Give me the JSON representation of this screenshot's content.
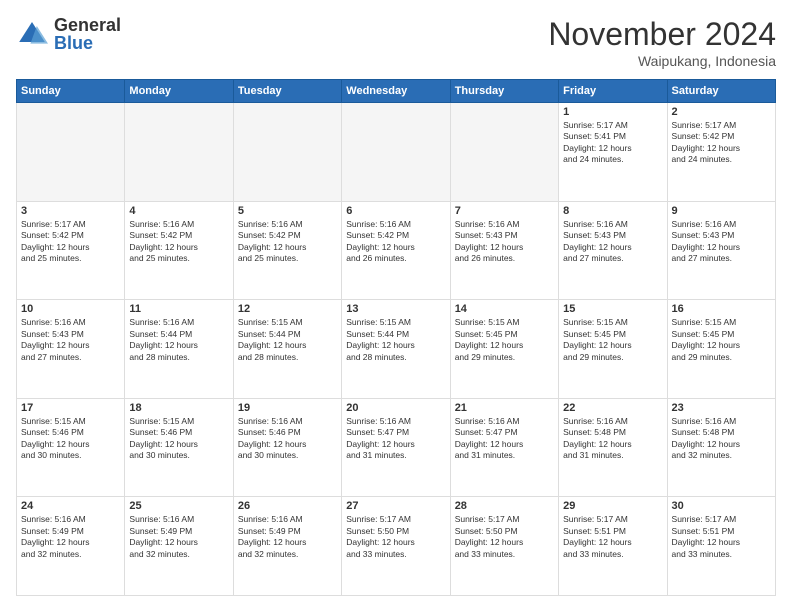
{
  "logo": {
    "general": "General",
    "blue": "Blue"
  },
  "header": {
    "month": "November 2024",
    "location": "Waipukang, Indonesia"
  },
  "weekdays": [
    "Sunday",
    "Monday",
    "Tuesday",
    "Wednesday",
    "Thursday",
    "Friday",
    "Saturday"
  ],
  "weeks": [
    [
      {
        "day": "",
        "info": ""
      },
      {
        "day": "",
        "info": ""
      },
      {
        "day": "",
        "info": ""
      },
      {
        "day": "",
        "info": ""
      },
      {
        "day": "",
        "info": ""
      },
      {
        "day": "1",
        "info": "Sunrise: 5:17 AM\nSunset: 5:41 PM\nDaylight: 12 hours\nand 24 minutes."
      },
      {
        "day": "2",
        "info": "Sunrise: 5:17 AM\nSunset: 5:42 PM\nDaylight: 12 hours\nand 24 minutes."
      }
    ],
    [
      {
        "day": "3",
        "info": "Sunrise: 5:17 AM\nSunset: 5:42 PM\nDaylight: 12 hours\nand 25 minutes."
      },
      {
        "day": "4",
        "info": "Sunrise: 5:16 AM\nSunset: 5:42 PM\nDaylight: 12 hours\nand 25 minutes."
      },
      {
        "day": "5",
        "info": "Sunrise: 5:16 AM\nSunset: 5:42 PM\nDaylight: 12 hours\nand 25 minutes."
      },
      {
        "day": "6",
        "info": "Sunrise: 5:16 AM\nSunset: 5:42 PM\nDaylight: 12 hours\nand 26 minutes."
      },
      {
        "day": "7",
        "info": "Sunrise: 5:16 AM\nSunset: 5:43 PM\nDaylight: 12 hours\nand 26 minutes."
      },
      {
        "day": "8",
        "info": "Sunrise: 5:16 AM\nSunset: 5:43 PM\nDaylight: 12 hours\nand 27 minutes."
      },
      {
        "day": "9",
        "info": "Sunrise: 5:16 AM\nSunset: 5:43 PM\nDaylight: 12 hours\nand 27 minutes."
      }
    ],
    [
      {
        "day": "10",
        "info": "Sunrise: 5:16 AM\nSunset: 5:43 PM\nDaylight: 12 hours\nand 27 minutes."
      },
      {
        "day": "11",
        "info": "Sunrise: 5:16 AM\nSunset: 5:44 PM\nDaylight: 12 hours\nand 28 minutes."
      },
      {
        "day": "12",
        "info": "Sunrise: 5:15 AM\nSunset: 5:44 PM\nDaylight: 12 hours\nand 28 minutes."
      },
      {
        "day": "13",
        "info": "Sunrise: 5:15 AM\nSunset: 5:44 PM\nDaylight: 12 hours\nand 28 minutes."
      },
      {
        "day": "14",
        "info": "Sunrise: 5:15 AM\nSunset: 5:45 PM\nDaylight: 12 hours\nand 29 minutes."
      },
      {
        "day": "15",
        "info": "Sunrise: 5:15 AM\nSunset: 5:45 PM\nDaylight: 12 hours\nand 29 minutes."
      },
      {
        "day": "16",
        "info": "Sunrise: 5:15 AM\nSunset: 5:45 PM\nDaylight: 12 hours\nand 29 minutes."
      }
    ],
    [
      {
        "day": "17",
        "info": "Sunrise: 5:15 AM\nSunset: 5:46 PM\nDaylight: 12 hours\nand 30 minutes."
      },
      {
        "day": "18",
        "info": "Sunrise: 5:15 AM\nSunset: 5:46 PM\nDaylight: 12 hours\nand 30 minutes."
      },
      {
        "day": "19",
        "info": "Sunrise: 5:16 AM\nSunset: 5:46 PM\nDaylight: 12 hours\nand 30 minutes."
      },
      {
        "day": "20",
        "info": "Sunrise: 5:16 AM\nSunset: 5:47 PM\nDaylight: 12 hours\nand 31 minutes."
      },
      {
        "day": "21",
        "info": "Sunrise: 5:16 AM\nSunset: 5:47 PM\nDaylight: 12 hours\nand 31 minutes."
      },
      {
        "day": "22",
        "info": "Sunrise: 5:16 AM\nSunset: 5:48 PM\nDaylight: 12 hours\nand 31 minutes."
      },
      {
        "day": "23",
        "info": "Sunrise: 5:16 AM\nSunset: 5:48 PM\nDaylight: 12 hours\nand 32 minutes."
      }
    ],
    [
      {
        "day": "24",
        "info": "Sunrise: 5:16 AM\nSunset: 5:49 PM\nDaylight: 12 hours\nand 32 minutes."
      },
      {
        "day": "25",
        "info": "Sunrise: 5:16 AM\nSunset: 5:49 PM\nDaylight: 12 hours\nand 32 minutes."
      },
      {
        "day": "26",
        "info": "Sunrise: 5:16 AM\nSunset: 5:49 PM\nDaylight: 12 hours\nand 32 minutes."
      },
      {
        "day": "27",
        "info": "Sunrise: 5:17 AM\nSunset: 5:50 PM\nDaylight: 12 hours\nand 33 minutes."
      },
      {
        "day": "28",
        "info": "Sunrise: 5:17 AM\nSunset: 5:50 PM\nDaylight: 12 hours\nand 33 minutes."
      },
      {
        "day": "29",
        "info": "Sunrise: 5:17 AM\nSunset: 5:51 PM\nDaylight: 12 hours\nand 33 minutes."
      },
      {
        "day": "30",
        "info": "Sunrise: 5:17 AM\nSunset: 5:51 PM\nDaylight: 12 hours\nand 33 minutes."
      }
    ]
  ]
}
